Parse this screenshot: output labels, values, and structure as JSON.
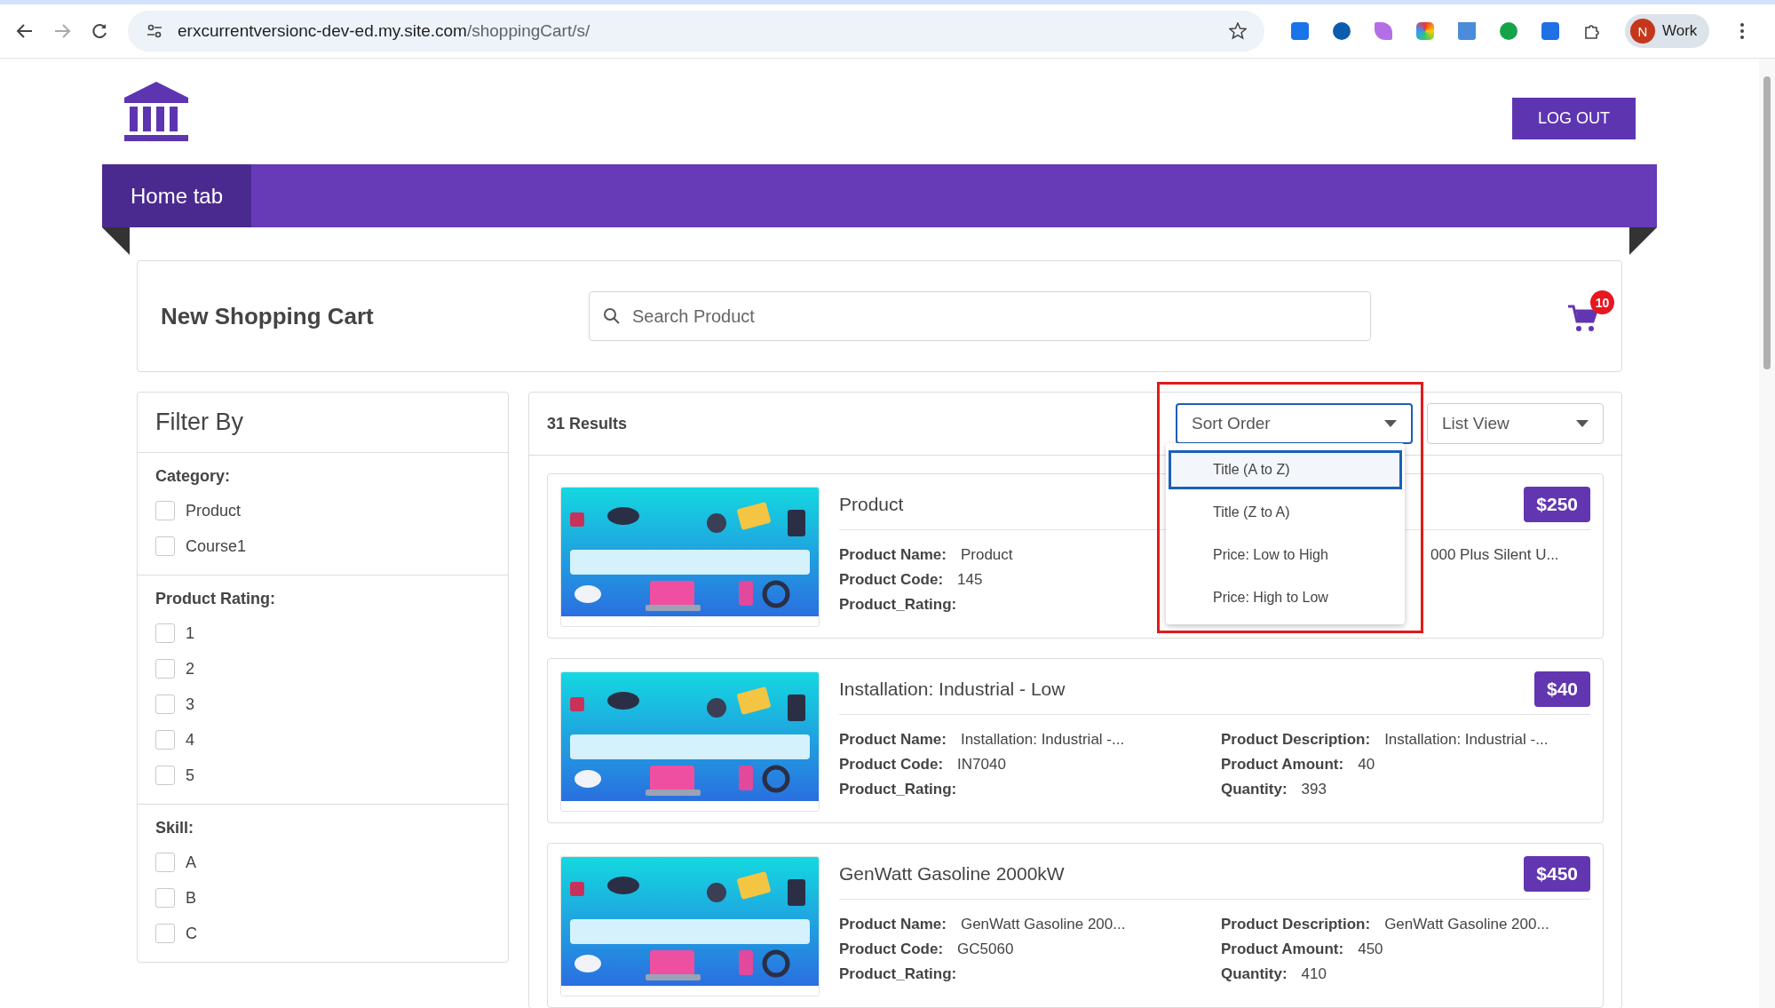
{
  "browser": {
    "url_host": "erxcurrentversionc-dev-ed.my.site.com",
    "url_path": "/shoppingCart/s/",
    "profile_initial": "N",
    "profile_label": "Work"
  },
  "header": {
    "logout": "LOG OUT"
  },
  "nav": {
    "tabs": [
      {
        "label": "Home tab",
        "selected": true
      }
    ]
  },
  "cart_header": {
    "title": "New Shopping Cart",
    "search_placeholder": "Search Product",
    "cart_count": "10"
  },
  "filters": {
    "title": "Filter By",
    "groups": [
      {
        "title": "Category:",
        "options": [
          {
            "label": "Product",
            "checked": false
          },
          {
            "label": "Course1",
            "checked": false
          }
        ]
      },
      {
        "title": "Product Rating:",
        "options": [
          {
            "label": "1",
            "checked": false
          },
          {
            "label": "2",
            "checked": false
          },
          {
            "label": "3",
            "checked": false
          },
          {
            "label": "4",
            "checked": false
          },
          {
            "label": "5",
            "checked": false
          }
        ]
      },
      {
        "title": "Skill:",
        "options": [
          {
            "label": "A",
            "checked": false
          },
          {
            "label": "B",
            "checked": false
          },
          {
            "label": "C",
            "checked": false
          }
        ]
      }
    ]
  },
  "results": {
    "count": "31 Results",
    "sort": {
      "placeholder": "Sort Order",
      "expanded": true,
      "highlighted": true,
      "options": [
        {
          "label": "Title (A to Z)",
          "selected": true
        },
        {
          "label": "Title (Z to A)",
          "selected": false
        },
        {
          "label": "Price: Low to High",
          "selected": false
        },
        {
          "label": "Price: High to Low",
          "selected": false
        }
      ]
    },
    "view": {
      "value": "List View"
    },
    "products": [
      {
        "title": "Product",
        "price": "$250",
        "left": [
          {
            "kind": "field",
            "label": "Product Name:",
            "value": "Product"
          },
          {
            "kind": "field",
            "label": "Product Code:",
            "value": "145"
          },
          {
            "kind": "field",
            "label": "Product_Rating:"
          }
        ],
        "right": [
          {
            "kind": "partial",
            "value": "000 Plus Silent U..."
          }
        ]
      },
      {
        "title": "Installation: Industrial - Low",
        "price": "$40",
        "left": [
          {
            "kind": "field",
            "label": "Product Name:",
            "value": "Installation: Industrial -..."
          },
          {
            "kind": "field",
            "label": "Product Code:",
            "value": "IN7040"
          },
          {
            "kind": "field",
            "label": "Product_Rating:"
          }
        ],
        "right": [
          {
            "kind": "field",
            "label": "Product Description:",
            "value": "Installation: Industrial -..."
          },
          {
            "kind": "field",
            "label": "Product Amount:",
            "value": "40"
          },
          {
            "kind": "field",
            "label": "Quantity:",
            "value": "393"
          }
        ]
      },
      {
        "title": "GenWatt Gasoline 2000kW",
        "price": "$450",
        "left": [
          {
            "kind": "field",
            "label": "Product Name:",
            "value": "GenWatt Gasoline 200..."
          },
          {
            "kind": "field",
            "label": "Product Code:",
            "value": "GC5060"
          },
          {
            "kind": "field",
            "label": "Product_Rating:"
          }
        ],
        "right": [
          {
            "kind": "field",
            "label": "Product Description:",
            "value": "GenWatt Gasoline 200..."
          },
          {
            "kind": "field",
            "label": "Product Amount:",
            "value": "450"
          },
          {
            "kind": "field",
            "label": "Quantity:",
            "value": "410"
          }
        ]
      }
    ]
  }
}
